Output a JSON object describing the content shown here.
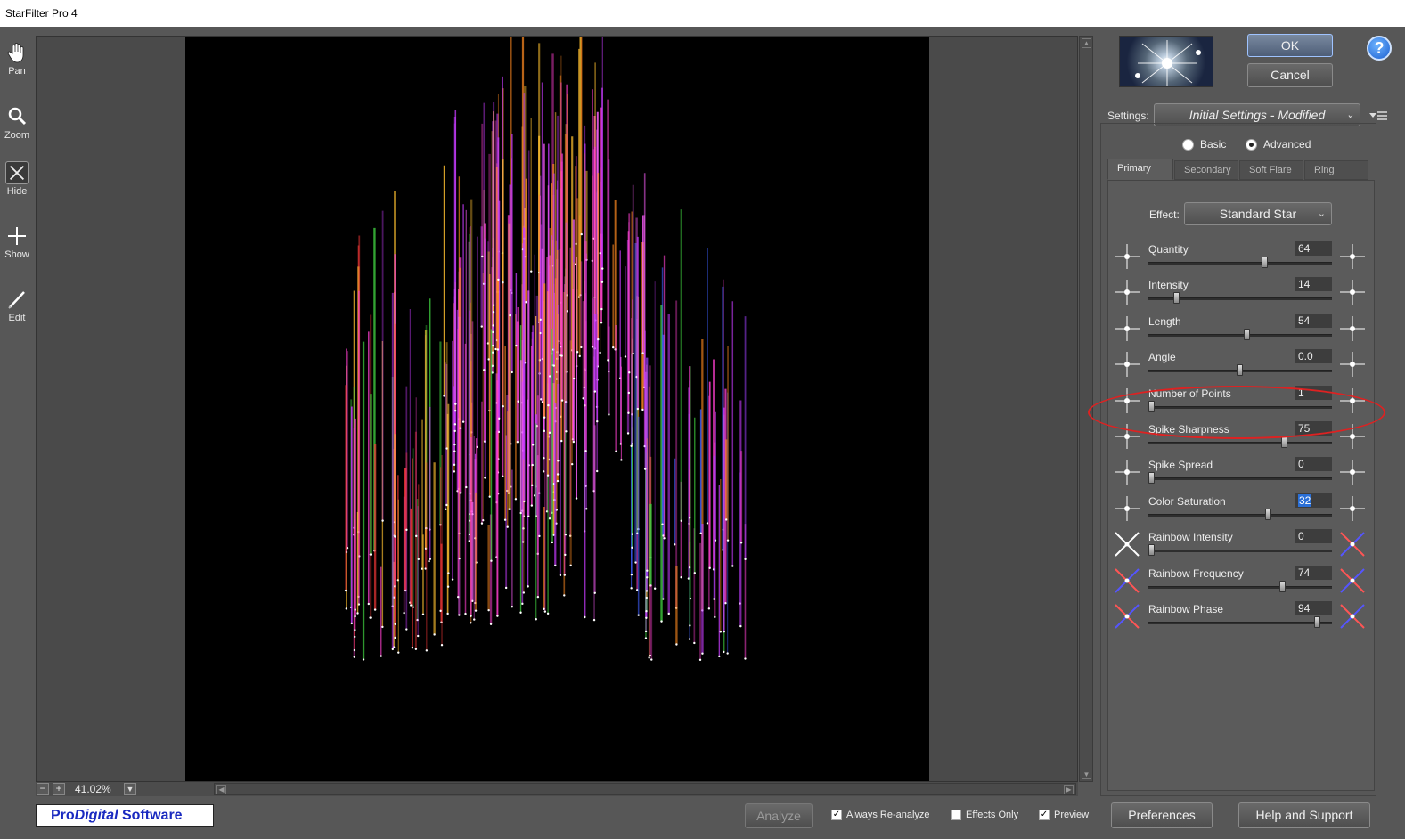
{
  "window": {
    "title": "StarFilter Pro 4"
  },
  "toolbar": {
    "tools": [
      {
        "label": "Pan",
        "icon": "hand-icon"
      },
      {
        "label": "Zoom",
        "icon": "magnifier-icon"
      },
      {
        "label": "Hide",
        "icon": "hide-x-icon"
      },
      {
        "label": "Show",
        "icon": "plus-icon"
      },
      {
        "label": "Edit",
        "icon": "pencil-icon"
      }
    ]
  },
  "preview": {
    "zoom": "41.02%"
  },
  "buttons": {
    "ok": "OK",
    "cancel": "Cancel",
    "help": "?"
  },
  "settings": {
    "label": "Settings:",
    "value": "Initial Settings - Modified"
  },
  "mode": {
    "basic": "Basic",
    "advanced": "Advanced",
    "selected": "Advanced"
  },
  "tabs": [
    {
      "label": "Primary",
      "active": true
    },
    {
      "label": "Secondary",
      "active": false
    },
    {
      "label": "Soft Flare",
      "active": false
    },
    {
      "label": "Ring Flare",
      "active": false
    }
  ],
  "effect": {
    "label": "Effect:",
    "value": "Standard Star"
  },
  "parameters": [
    {
      "name": "Quantity",
      "value": "64",
      "fraction": 0.64
    },
    {
      "name": "Intensity",
      "value": "14",
      "fraction": 0.14
    },
    {
      "name": "Length",
      "value": "54",
      "fraction": 0.54
    },
    {
      "name": "Angle",
      "value": "0.0",
      "fraction": 0.5
    },
    {
      "name": "Number of Points",
      "value": "1",
      "fraction": 0.0
    },
    {
      "name": "Spike Sharpness",
      "value": "75",
      "fraction": 0.75
    },
    {
      "name": "Spike Spread",
      "value": "0",
      "fraction": 0.0
    },
    {
      "name": "Color Saturation",
      "value": "32",
      "fraction": 0.66
    },
    {
      "name": "Rainbow Intensity",
      "value": "0",
      "fraction": 0.0
    },
    {
      "name": "Rainbow Frequency",
      "value": "74",
      "fraction": 0.74
    },
    {
      "name": "Rainbow Phase",
      "value": "94",
      "fraction": 0.94
    }
  ],
  "footer": {
    "brand_pro": "Pro",
    "brand_digital": "Digital",
    "brand_software": " Software",
    "analyze": "Analyze",
    "always_reanalyze": "Always Re-analyze",
    "effects_only": "Effects Only",
    "preview": "Preview",
    "preferences": "Preferences",
    "help_support": "Help and Support"
  },
  "colors": {
    "highlight_oval": "#dd2222",
    "selected_value": "#2a6fd6"
  }
}
